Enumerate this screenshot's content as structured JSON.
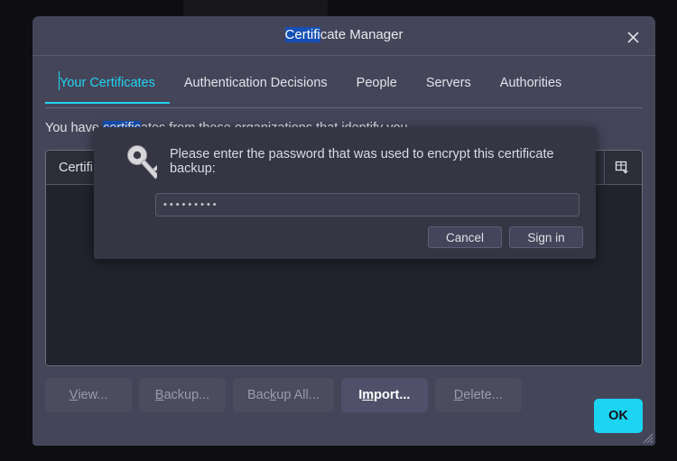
{
  "window": {
    "title_prefix": "Certifi",
    "title_suffix": "cate Manager",
    "close_icon": "close-icon"
  },
  "tabs": [
    {
      "label": "Your Certificates",
      "active": true
    },
    {
      "label": "Authentication Decisions",
      "active": false
    },
    {
      "label": "People",
      "active": false
    },
    {
      "label": "Servers",
      "active": false
    },
    {
      "label": "Authorities",
      "active": false
    }
  ],
  "description": {
    "before": "You have ",
    "selected": "certific",
    "after": "ates from these organizations that identify you"
  },
  "list": {
    "column_header": "Certifi",
    "config_icon": "table-columns-icon",
    "rows": []
  },
  "actions": [
    {
      "label_pre": "",
      "accel": "V",
      "label_post": "iew...",
      "state": "disabled",
      "name": "view-button"
    },
    {
      "label_pre": "",
      "accel": "B",
      "label_post": "ackup...",
      "state": "disabled",
      "name": "backup-button"
    },
    {
      "label_pre": "Bac",
      "accel": "k",
      "label_post": "up All...",
      "state": "disabled",
      "name": "backup-all-button"
    },
    {
      "label_pre": "I",
      "accel": "m",
      "label_post": "port...",
      "state": "enabled",
      "name": "import-button"
    },
    {
      "label_pre": "",
      "accel": "D",
      "label_post": "elete...",
      "state": "disabled",
      "name": "delete-button"
    }
  ],
  "ok_button": {
    "label": "OK",
    "color": "#1ad4f2"
  },
  "modal": {
    "icon": "key-icon",
    "message": "Please enter the password that was used to encrypt this certificate backup:",
    "password_value": "•••••••••",
    "password_placeholder": "",
    "cancel_label": "Cancel",
    "signin_label": "Sign in"
  },
  "colors": {
    "selection_blue": "#1550b5",
    "accent_cyan": "#1fd3f0",
    "window_bg": "#45455a",
    "modal_bg": "#353544",
    "list_bg": "#23232e"
  }
}
